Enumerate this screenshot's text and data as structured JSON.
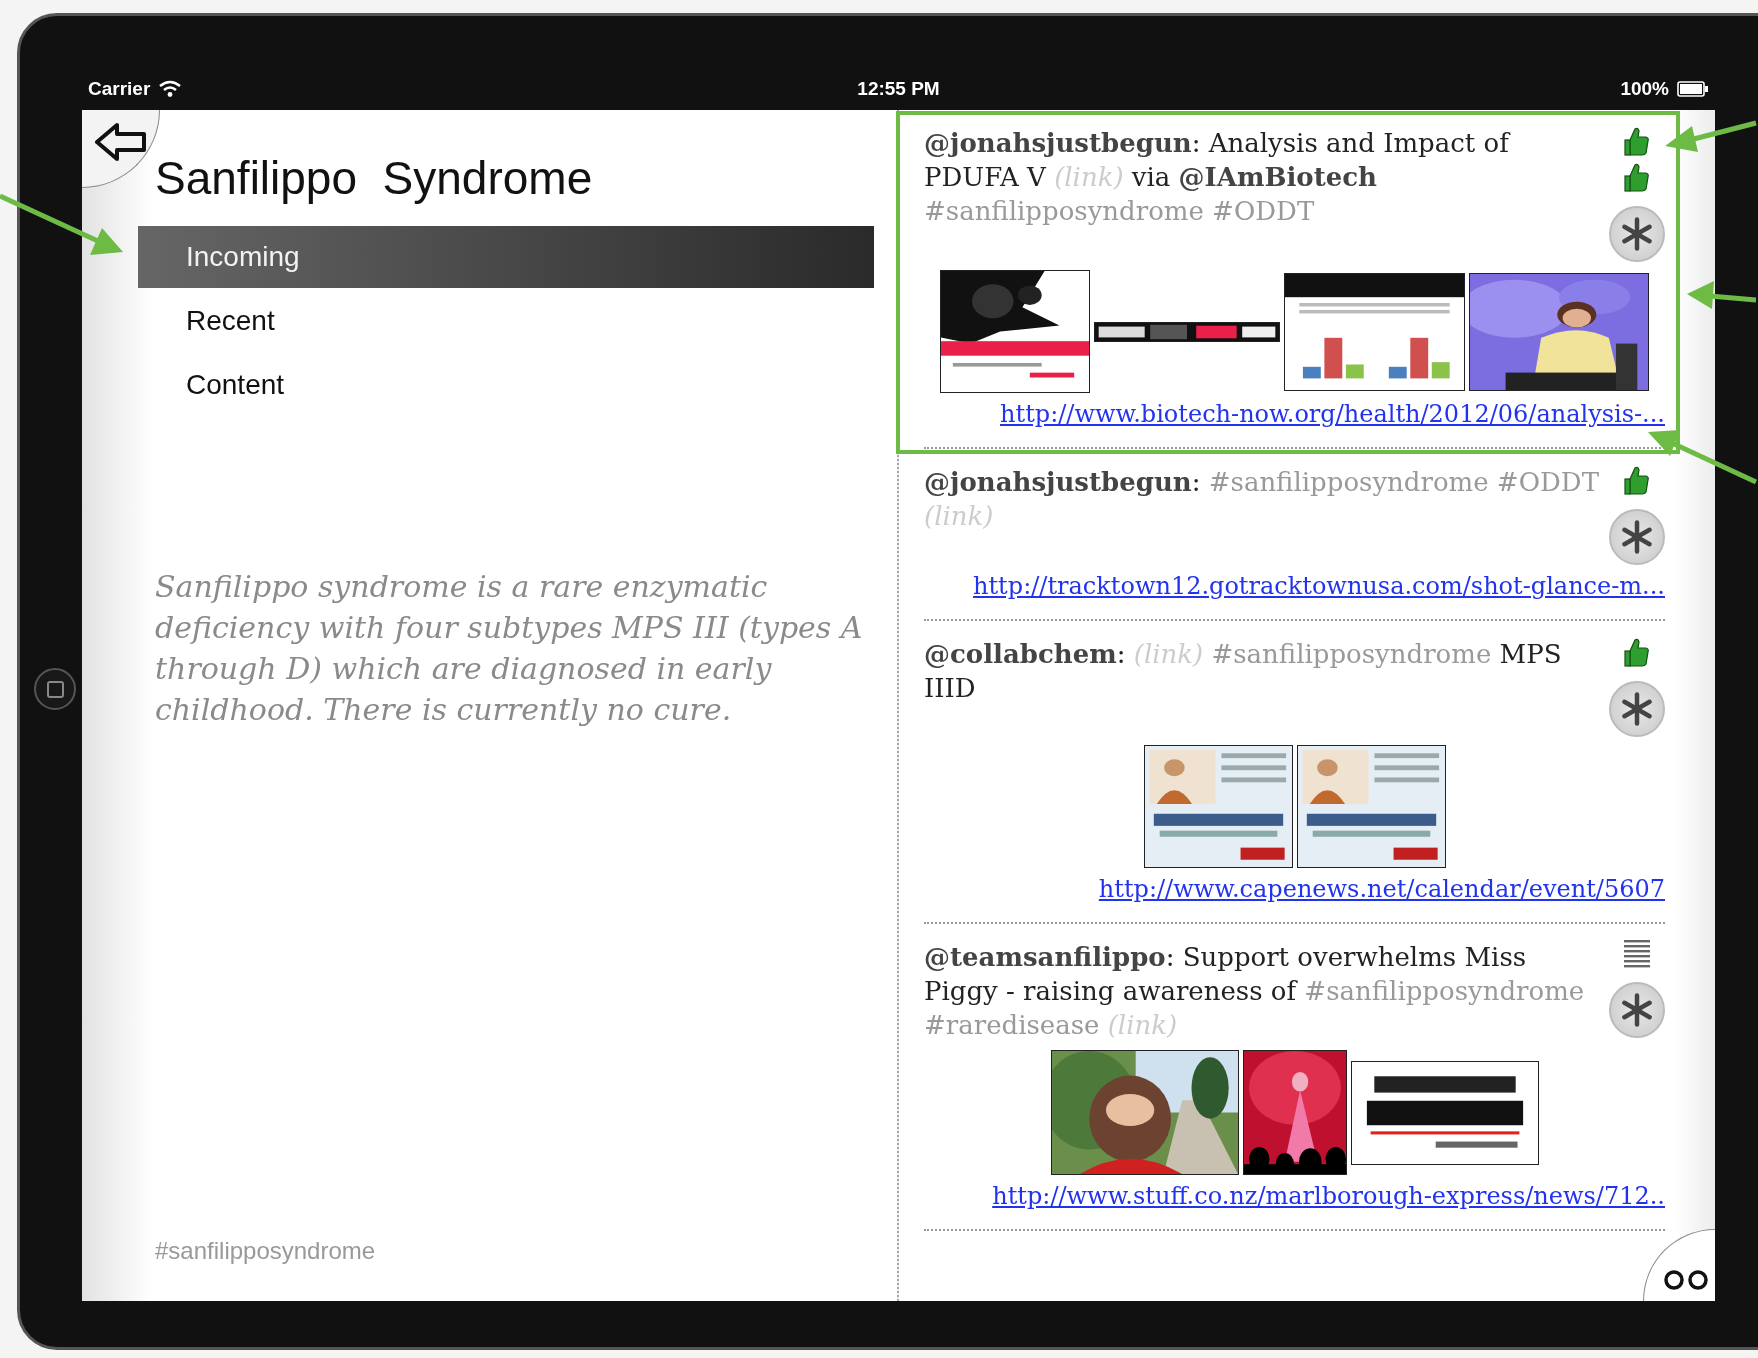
{
  "status_bar": {
    "carrier": "Carrier",
    "time": "12:55 PM",
    "battery": "100%"
  },
  "sidebar": {
    "title": "Sanfilippo  Syndrome",
    "items": [
      {
        "label": "Incoming",
        "selected": true
      },
      {
        "label": "Recent",
        "selected": false
      },
      {
        "label": "Content",
        "selected": false
      }
    ],
    "description": "Sanfilippo syndrome is a rare enzymatic deficiency with four subtypes MPS III (types A through D) which are diagnosed in early childhood. There is currently no cure.",
    "hashtag": "#sanfilipposyndrome"
  },
  "feed": {
    "tweets": [
      {
        "segments": [
          {
            "kind": "handle",
            "text": "@jonahsjustbegun"
          },
          {
            "kind": "text",
            "text": ": Analysis and Impact of PDUFA V "
          },
          {
            "kind": "link",
            "text": "(link)"
          },
          {
            "kind": "text",
            "text": " via "
          },
          {
            "kind": "handle",
            "text": "@IAmBiotech"
          },
          {
            "kind": "hashtag",
            "text": " #sanfilipposyndrome #ODDT"
          }
        ],
        "badges": [
          {
            "kind": "thumbs-up"
          },
          {
            "kind": "thumbs-up"
          }
        ],
        "images": [
          {
            "kind": "picture"
          },
          {
            "kind": "picture"
          },
          {
            "kind": "picture"
          },
          {
            "kind": "picture"
          }
        ],
        "url": "http://www.biotech-now.org/health/2012/06/analysis-..."
      },
      {
        "segments": [
          {
            "kind": "handle",
            "text": "@jonahsjustbegun"
          },
          {
            "kind": "text",
            "text": ": "
          },
          {
            "kind": "hashtag",
            "text": "#sanfilipposyndrome #ODDT "
          },
          {
            "kind": "link",
            "text": "(link)"
          }
        ],
        "badges": [
          {
            "kind": "thumbs-up"
          }
        ],
        "url": "http://tracktown12.gotracktownusa.com/shot-glance-m..."
      },
      {
        "segments": [
          {
            "kind": "handle",
            "text": "@collabchem"
          },
          {
            "kind": "text",
            "text": ": "
          },
          {
            "kind": "link",
            "text": "(link)"
          },
          {
            "kind": "hashtag",
            "text": " #sanfilipposyndrome"
          },
          {
            "kind": "text",
            "text": " MPS IIID"
          }
        ],
        "badges": [
          {
            "kind": "thumbs-up"
          }
        ],
        "images": [
          {
            "kind": "picture"
          },
          {
            "kind": "picture"
          }
        ],
        "url": "http://www.capenews.net/calendar/event/5607"
      },
      {
        "segments": [
          {
            "kind": "handle",
            "text": "@teamsanfilippo"
          },
          {
            "kind": "text",
            "text": ": Support overwhelms Miss Piggy - raising awareness of "
          },
          {
            "kind": "hashtag",
            "text": "#sanfilipposyndrome #raredisease "
          },
          {
            "kind": "link",
            "text": "(link)"
          }
        ],
        "badges": [
          {
            "kind": "list"
          }
        ],
        "images": [
          {
            "kind": "picture"
          },
          {
            "kind": "picture"
          },
          {
            "kind": "picture"
          }
        ],
        "url": "http://www.stuff.co.nz/marlborough-express/news/712.."
      }
    ]
  }
}
